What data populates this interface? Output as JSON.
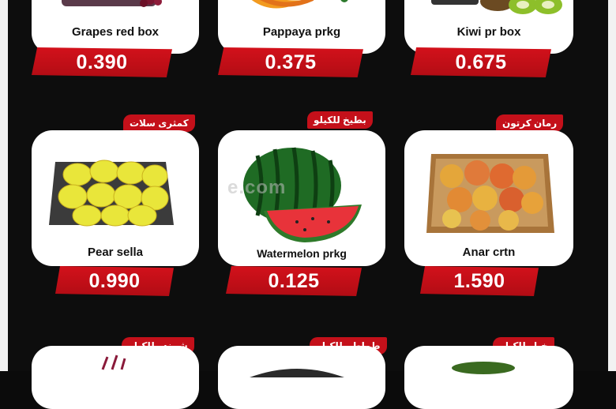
{
  "products": [
    {
      "name": "Grapes red box",
      "price": "0.390",
      "arabic": ""
    },
    {
      "name": "Pappaya prkg",
      "price": "0.375",
      "arabic": ""
    },
    {
      "name": "Kiwi pr box",
      "price": "0.675",
      "arabic": ""
    },
    {
      "name": "Pear sella",
      "price": "0.990",
      "arabic": "كمثرى سلات"
    },
    {
      "name": "Watermelon prkg",
      "price": "0.125",
      "arabic": "بطيخ للكيلو"
    },
    {
      "name": "Anar crtn",
      "price": "1.590",
      "arabic": "رمان كرتون"
    },
    {
      "name": "",
      "price": "",
      "arabic": "شمندر للكيلو"
    },
    {
      "name": "",
      "price": "",
      "arabic": "طماطم للكيلو"
    },
    {
      "name": "",
      "price": "",
      "arabic": "خيار للكيلو"
    }
  ],
  "watermark": "e.com",
  "colors": {
    "accent": "#c4101a",
    "background": "#0d0d0d",
    "card": "#ffffff"
  },
  "icons": [
    "grapes-icon",
    "papaya-icon",
    "kiwi-icon",
    "pear-crate-icon",
    "watermelon-icon",
    "pomegranate-crate-icon",
    "beetroot-icon",
    "tomato-icon",
    "cucumber-icon"
  ]
}
